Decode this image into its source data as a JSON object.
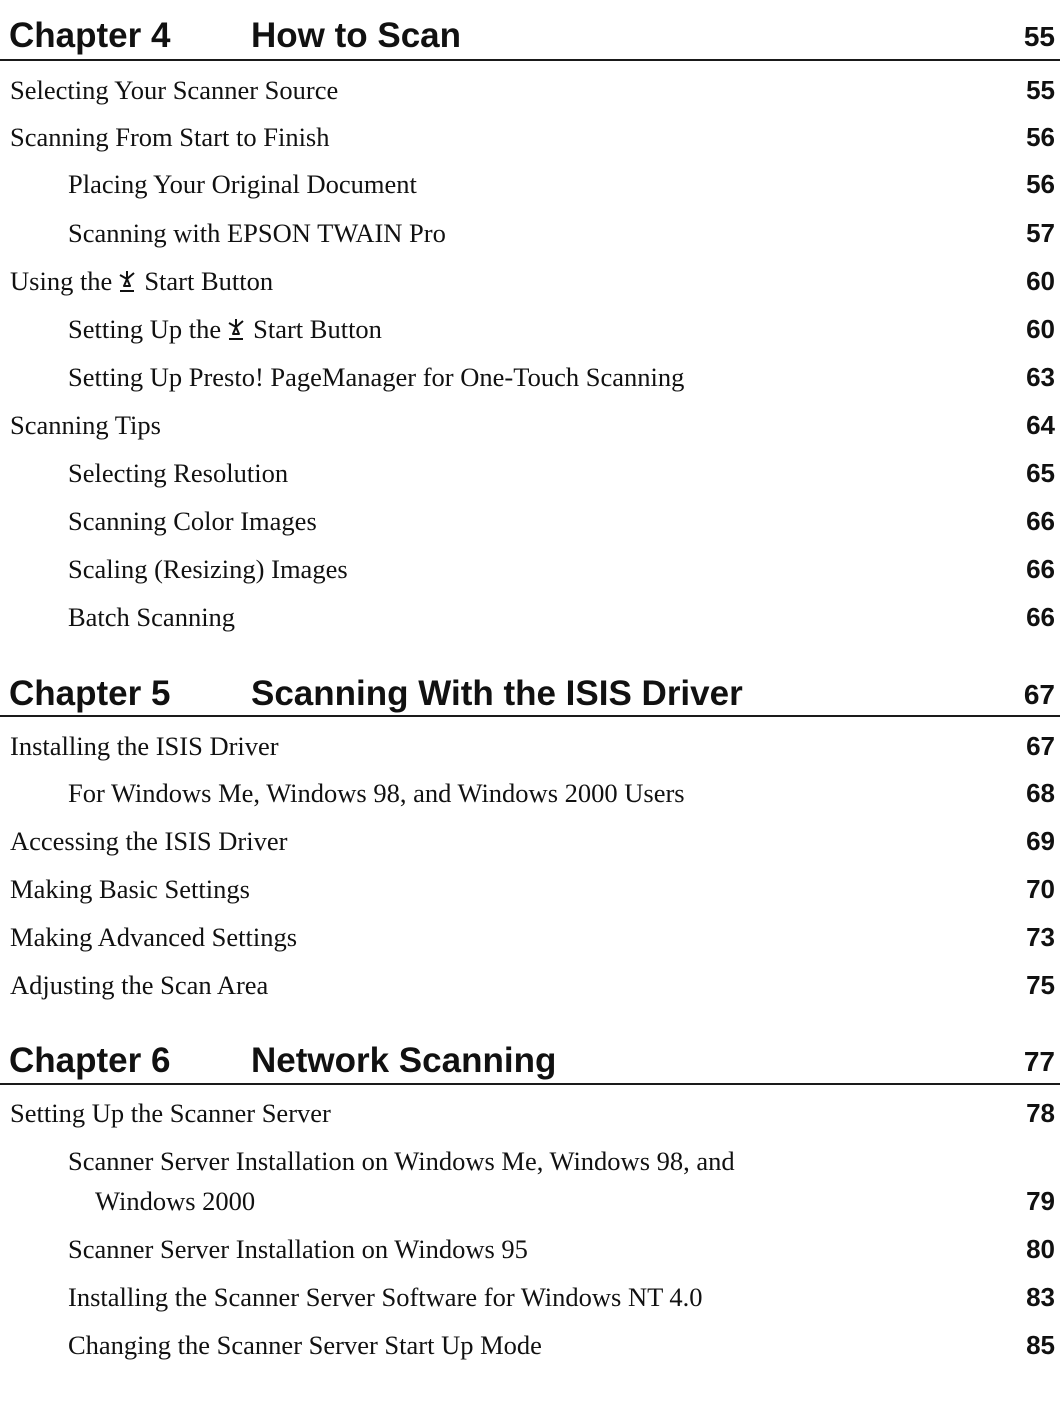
{
  "chapters": [
    {
      "number": "Chapter 4",
      "title": "How to Scan",
      "page": "55",
      "entries": [
        {
          "text": "Selecting Your Scanner Source",
          "page": "55"
        },
        {
          "text": "Scanning From Start to Finish",
          "page": "56"
        },
        {
          "text": "Placing Your Original Document",
          "page": "56"
        },
        {
          "text": "Scanning with EPSON TWAIN Pro",
          "page": "57"
        },
        {
          "text_before": "Using the",
          "text_after": "Start Button",
          "page": "60",
          "icon": "start-button-icon"
        },
        {
          "text_before": "Setting Up the",
          "text_after": "Start Button",
          "page": "60",
          "icon": "start-button-icon"
        },
        {
          "text": "Setting Up Presto! PageManager for One-Touch Scanning",
          "page": "63"
        },
        {
          "text": "Scanning Tips",
          "page": "64"
        },
        {
          "text": "Selecting Resolution",
          "page": "65"
        },
        {
          "text": "Scanning Color Images",
          "page": "66"
        },
        {
          "text": "Scaling (Resizing) Images",
          "page": "66"
        },
        {
          "text": "Batch Scanning",
          "page": "66"
        }
      ]
    },
    {
      "number": "Chapter 5",
      "title": "Scanning With the ISIS Driver",
      "page": "67",
      "entries": [
        {
          "text": "Installing the ISIS Driver",
          "page": "67"
        },
        {
          "text": "For Windows Me, Windows 98, and Windows 2000 Users",
          "page": "68"
        },
        {
          "text": "Accessing the ISIS Driver",
          "page": "69"
        },
        {
          "text": "Making Basic Settings",
          "page": "70"
        },
        {
          "text": "Making Advanced Settings",
          "page": "73"
        },
        {
          "text": "Adjusting the Scan Area",
          "page": "75"
        }
      ]
    },
    {
      "number": "Chapter 6",
      "title": "Network Scanning",
      "page": "77",
      "entries": [
        {
          "text": "Setting Up the Scanner Server",
          "page": "78"
        },
        {
          "text_line1": "Scanner Server Installation on Windows Me, Windows 98, and",
          "text_line2": "Windows 2000",
          "page": "79"
        },
        {
          "text": "Scanner Server Installation on Windows 95",
          "page": "80"
        },
        {
          "text": "Installing the Scanner Server Software for Windows NT 4.0",
          "page": "83"
        },
        {
          "text": "Changing the Scanner Server Start Up Mode",
          "page": "85"
        }
      ]
    }
  ]
}
